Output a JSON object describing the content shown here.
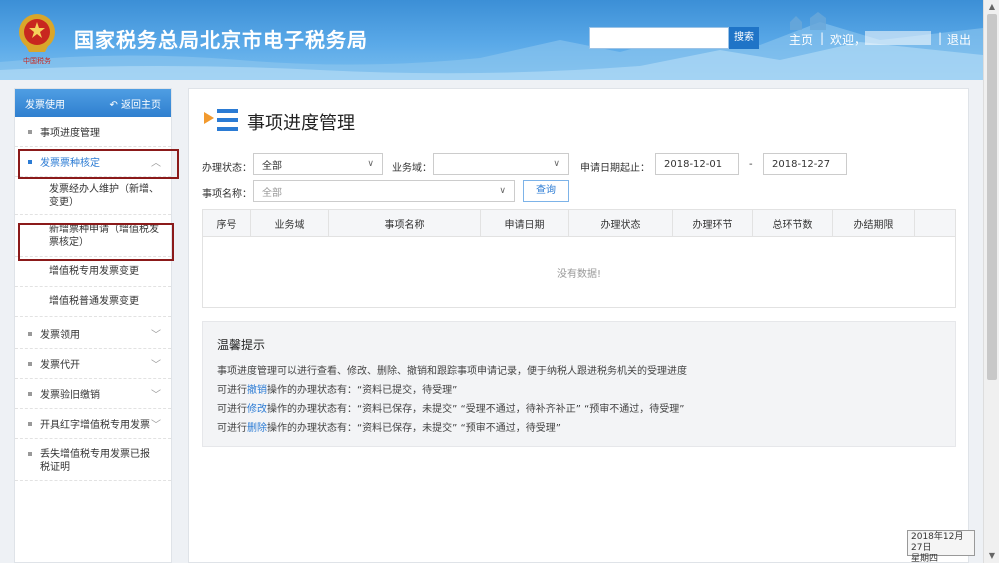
{
  "header": {
    "title": "国家税务总局北京市电子税务局",
    "search_placeholder": "",
    "search_button": "搜索",
    "home": "主页",
    "separator": "|",
    "welcome": "欢迎，",
    "logout": "退出",
    "emblem_text": "中国税务",
    "emblem_icon": "tax-emblem-icon"
  },
  "sidebar": {
    "header_label": "发票使用",
    "back_label": "返回主页",
    "items": [
      {
        "label": "事项进度管理",
        "expandable": false
      },
      {
        "label": "发票票种核定",
        "expandable": true,
        "expanded": true
      },
      {
        "label": "发票领用",
        "expandable": true
      },
      {
        "label": "发票代开",
        "expandable": true
      },
      {
        "label": "发票验旧缴销",
        "expandable": true
      },
      {
        "label": "开具红字增值税专用发票",
        "expandable": true
      },
      {
        "label": "丢失增值税专用发票已报税证明",
        "expandable": false
      }
    ],
    "sub_items": [
      {
        "label": "发票经办人维护（新增、变更）"
      },
      {
        "label": "新增票种申请（增值税发票核定）"
      },
      {
        "label": "增值税专用发票变更"
      },
      {
        "label": "增值税普通发票变更"
      }
    ]
  },
  "main": {
    "title": "事项进度管理",
    "filters": {
      "status_label": "办理状态：",
      "status_value": "全部",
      "domain_label": "业务域：",
      "domain_value": "",
      "date_label": "申请日期起止：",
      "date_start": "2018-12-01",
      "date_sep": "-",
      "date_end": "2018-12-27",
      "item_name_label": "事项名称：",
      "item_name_value": "全部",
      "query_button": "查询"
    },
    "table": {
      "columns": [
        "序号",
        "业务域",
        "事项名称",
        "申请日期",
        "办理状态",
        "办理环节",
        "总环节数",
        "办结期限"
      ],
      "empty_text": "没有数据!"
    },
    "tips": {
      "title": "温馨提示",
      "line1": "事项进度管理可以进行查看、修改、删除、撤销和跟踪事项申请记录，便于纳税人跟进税务机关的受理进度",
      "line2_pre": "可进行",
      "line2_link": "撤销",
      "line2_post": "操作的办理状态有：“资料已提交，待受理”",
      "line3_pre": "可进行",
      "line3_link": "修改",
      "line3_post": "操作的办理状态有：“资料已保存，未提交”  “受理不通过，待补齐补正”  “预审不通过，待受理”",
      "line4_pre": "可进行",
      "line4_link": "删除",
      "line4_post": "操作的办理状态有：“资料已保存，未提交”  “预审不通过，待受理”"
    }
  },
  "clock": {
    "date": "2018年12月27日",
    "weekday": "星期四"
  },
  "colors": {
    "header_blue": "#3c8fd6",
    "accent": "#2b7bd4",
    "highlight_border": "#8b1a1a"
  }
}
